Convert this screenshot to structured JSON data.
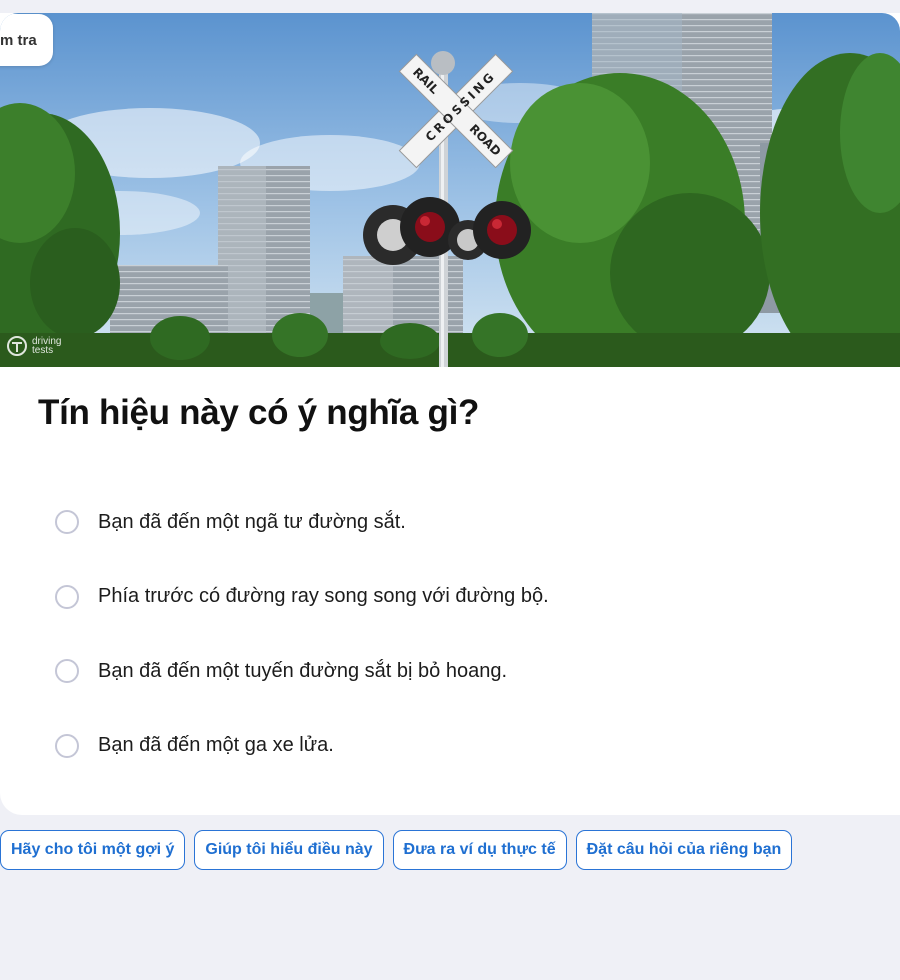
{
  "hero": {
    "tag_label": "m tra",
    "sign_text_left": "RAIL",
    "sign_text_right": "ROAD",
    "sign_text_cross": "CROSSING",
    "logo_text_1": "driving",
    "logo_text_2": "tests"
  },
  "question": {
    "title": "Tín hiệu này có ý nghĩa gì?",
    "options": [
      {
        "label": "Bạn đã đến một ngã tư đường sắt."
      },
      {
        "label": "Phía trước có đường ray song song với đường bộ."
      },
      {
        "label": "Bạn đã đến một tuyến đường sắt bị bỏ hoang."
      },
      {
        "label": "Bạn đã đến một ga xe lửa."
      }
    ]
  },
  "actions": [
    {
      "label": "Hãy cho tôi một gợi ý"
    },
    {
      "label": "Giúp tôi hiểu điều này"
    },
    {
      "label": "Đưa ra ví dụ thực tế"
    },
    {
      "label": "Đặt câu hỏi của riêng bạn"
    }
  ],
  "colors": {
    "accent": "#1f6fd1",
    "background": "#eff0f6",
    "radio_border": "#c4c6d6"
  }
}
